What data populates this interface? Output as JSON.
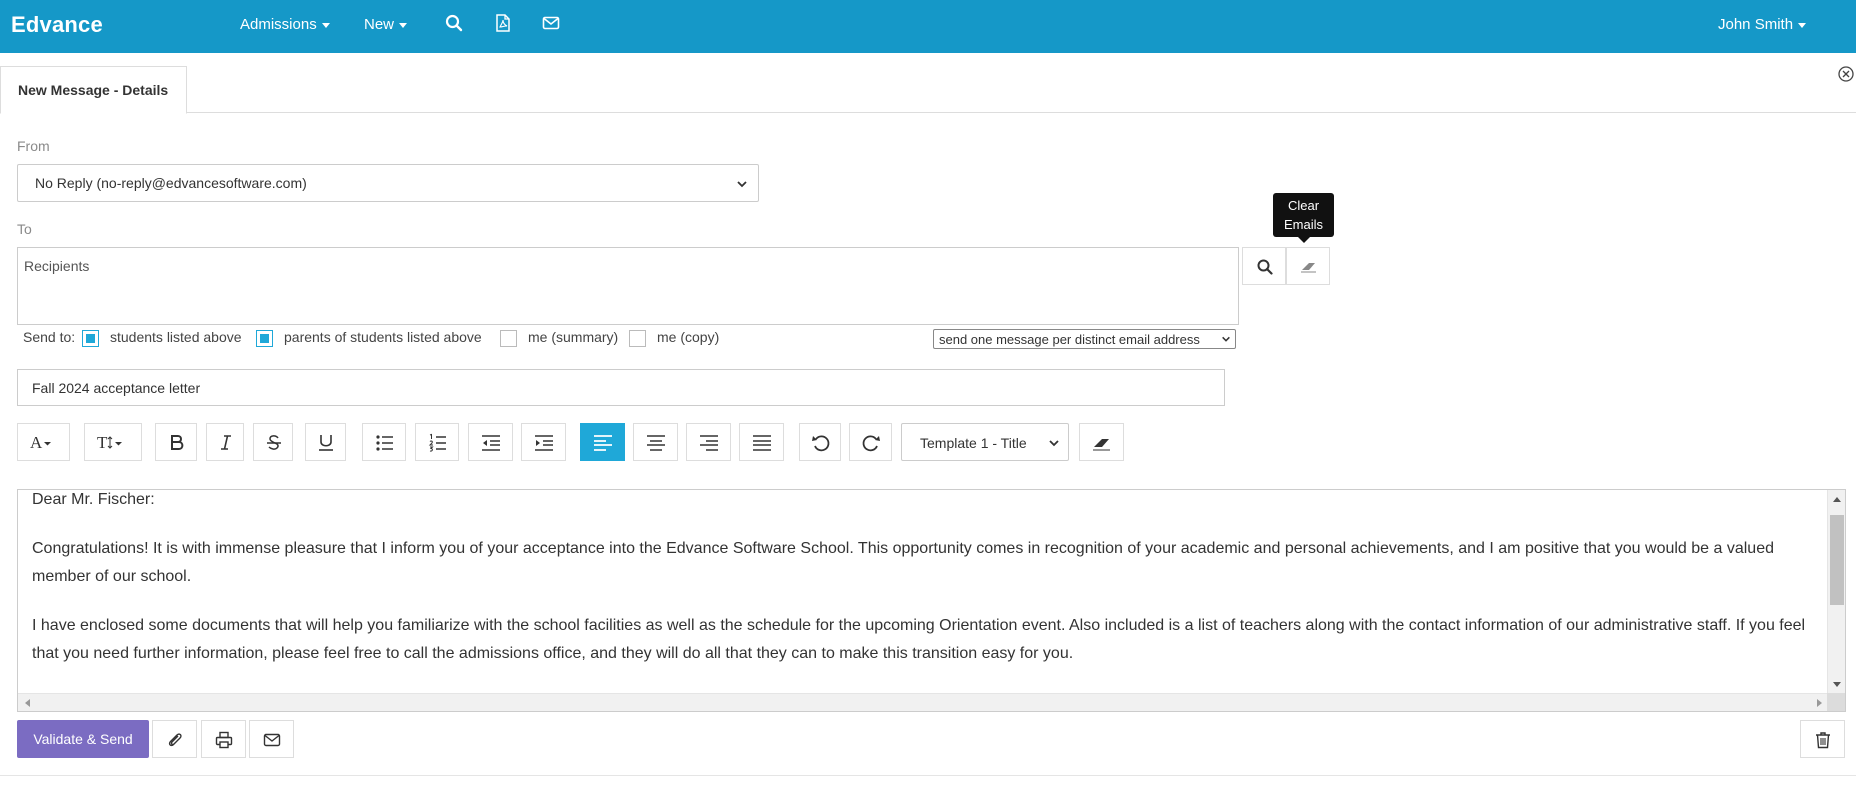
{
  "colors": {
    "topbar": "#1598c8",
    "accent": "#1fa8d8",
    "send_button": "#7b6cc2"
  },
  "topbar": {
    "brand": "Edvance",
    "menu_admissions": "Admissions",
    "menu_new": "New",
    "icons": [
      "search-icon",
      "pdf-icon",
      "envelope-icon"
    ],
    "user": "John Smith"
  },
  "tab": {
    "title": "New Message - Details"
  },
  "form": {
    "from_label": "From",
    "from_value": "No Reply (no-reply@edvancesoftware.com)",
    "to_label": "To",
    "recipients_placeholder": "Recipients",
    "clear_tooltip_line1": "Clear",
    "clear_tooltip_line2": "Emails",
    "send_to_label": "Send to:",
    "options": [
      {
        "label": "students listed above",
        "checked": true
      },
      {
        "label": "parents of students listed above",
        "checked": true
      },
      {
        "label": "me (summary)",
        "checked": false
      },
      {
        "label": "me (copy)",
        "checked": false
      }
    ],
    "delivery_mode": "send one message per distinct email address",
    "subject": "Fall 2024 acceptance letter"
  },
  "toolbar": {
    "font_letter": "A",
    "size_letter": "T",
    "template": "Template 1 - Title",
    "active_alignment": "align-left"
  },
  "editor": {
    "greeting": "Dear Mr. Fischer:",
    "paragraph1": "Congratulations! It is with immense pleasure that I inform you of your acceptance into the Edvance Software School. This opportunity comes in recognition of your academic and personal achievements, and I am positive that you would be a valued member of our school.",
    "paragraph2": "I have enclosed some documents that will help you familiarize with the school facilities as well as the schedule for the upcoming Orientation event. Also included is a list of teachers along with the contact information of our administrative staff. If you feel that you need further information, please feel free to call the admissions office, and they will do all that they can to make this transition easy for you."
  },
  "footer": {
    "send_label": "Validate & Send"
  }
}
